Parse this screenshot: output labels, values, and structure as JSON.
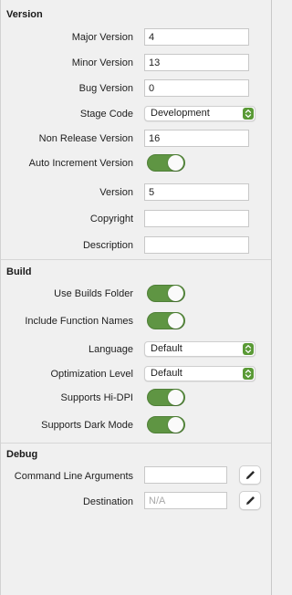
{
  "version": {
    "title": "Version",
    "major_label": "Major Version",
    "major_value": "4",
    "minor_label": "Minor Version",
    "minor_value": "13",
    "bug_label": "Bug Version",
    "bug_value": "0",
    "stage_label": "Stage Code",
    "stage_value": "Development",
    "nonrelease_label": "Non Release Version",
    "nonrelease_value": "16",
    "autoinc_label": "Auto Increment Version",
    "autoinc_on": true,
    "version_label": "Version",
    "version_value": "5",
    "copyright_label": "Copyright",
    "copyright_value": "",
    "description_label": "Description",
    "description_value": ""
  },
  "build": {
    "title": "Build",
    "builds_folder_label": "Use Builds Folder",
    "builds_folder_on": true,
    "function_names_label": "Include Function Names",
    "function_names_on": true,
    "language_label": "Language",
    "language_value": "Default",
    "optimization_label": "Optimization Level",
    "optimization_value": "Default",
    "hidpi_label": "Supports Hi-DPI",
    "hidpi_on": true,
    "darkmode_label": "Supports Dark Mode",
    "darkmode_on": true
  },
  "debug": {
    "title": "Debug",
    "cmdline_label": "Command Line Arguments",
    "cmdline_value": "",
    "destination_label": "Destination",
    "destination_placeholder": "N/A"
  },
  "colors": {
    "toggle_on": "#5f9543",
    "accent": "#5a9a36"
  },
  "icons": {
    "stepper": "updown-stepper-icon",
    "edit": "pencil-icon"
  }
}
